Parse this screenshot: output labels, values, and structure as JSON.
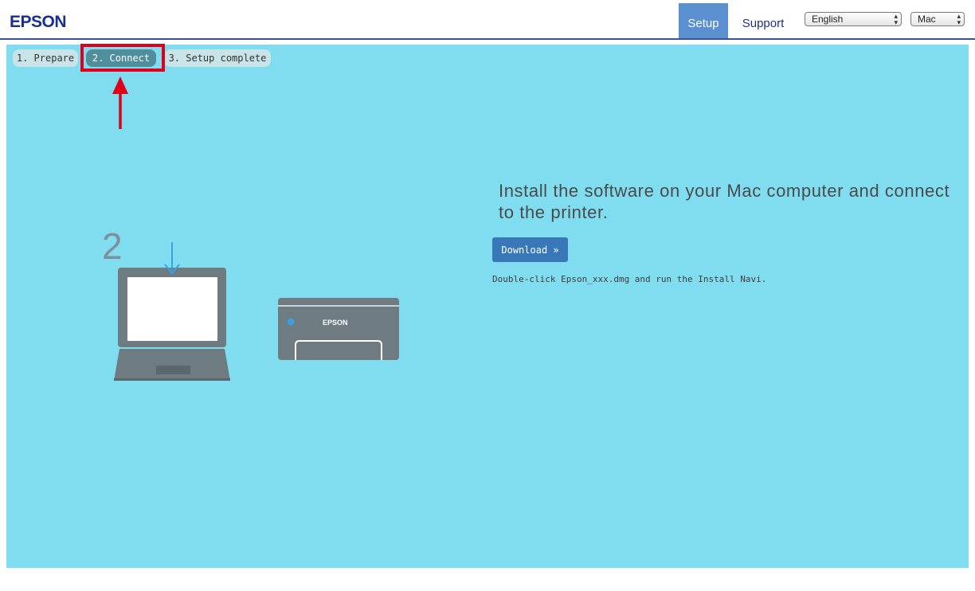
{
  "header": {
    "logo": "EPSON",
    "nav": {
      "setup": "Setup",
      "support": "Support"
    },
    "language_select": {
      "value": "English"
    },
    "os_select": {
      "value": "Mac"
    }
  },
  "steps": [
    {
      "label": "1. Prepare",
      "active": false
    },
    {
      "label": "2. Connect",
      "active": true
    },
    {
      "label": "3. Setup complete",
      "active": false
    }
  ],
  "illustration": {
    "step_number": "2",
    "printer_brand": "EPSON"
  },
  "main": {
    "headline": "Install the software on your Mac computer and connect to the printer.",
    "download_label": "Download »",
    "hint": "Double-click Epson_xxx.dmg and run the Install Navi."
  },
  "colors": {
    "panel_bg": "#80dcef",
    "brand_blue": "#1a2f8e",
    "active_nav": "#5a8fd0",
    "active_step": "#4f8e9c",
    "button_blue": "#3978b8",
    "highlight_red": "#e0001a",
    "device_gray": "#6e7b80"
  },
  "icons": {
    "download_arrow": "download-arrow-icon",
    "callout": "red-arrow-up-icon"
  }
}
